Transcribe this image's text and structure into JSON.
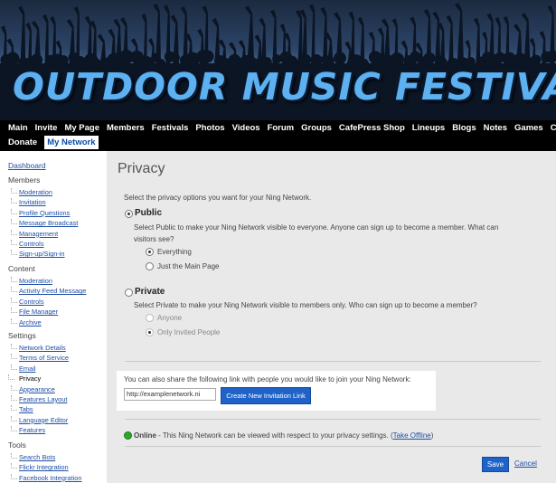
{
  "site": {
    "title": "OUTDOOR MUSIC FESTIVALS"
  },
  "nav": {
    "row1": [
      "Main",
      "Invite",
      "My Page",
      "Members",
      "Festivals",
      "Photos",
      "Videos",
      "Forum",
      "Groups",
      "CafePress Shop",
      "Lineups",
      "Blogs",
      "Notes",
      "Games",
      "Chat"
    ],
    "row2": [
      "Donate",
      "My Network"
    ],
    "active": "My Network"
  },
  "sidebar": {
    "dashboard": "Dashboard",
    "sections": [
      {
        "heading": "Members",
        "items": [
          "Moderation",
          "Invitation",
          "Profile Questions",
          "Message Broadcast",
          "Management",
          "Controls",
          "Sign-up/Sign-in"
        ]
      },
      {
        "heading": "Content",
        "items": [
          "Moderation",
          "Activity Feed Message",
          "Controls",
          "File Manager",
          "Archive"
        ]
      },
      {
        "heading": "Settings",
        "items": [
          "Network Details",
          "Terms of Service",
          "Email",
          "Privacy",
          "Appearance",
          "Features Layout",
          "Tabs",
          "Language Editor",
          "Features"
        ]
      },
      {
        "heading": "Tools",
        "items": [
          "Search Bots",
          "Flickr Integration",
          "Facebook Integration"
        ]
      }
    ],
    "current": "Privacy"
  },
  "main": {
    "title": "Privacy",
    "intro": "Select the privacy options you want for your Ning Network.",
    "public": {
      "label": "Public",
      "desc_line1": "Select Public to make your Ning Network visible to everyone. Anyone can sign up to become a member. What can",
      "desc_line2": "visitors see?",
      "options": [
        "Everything",
        "Just the Main Page"
      ],
      "selected": "Everything"
    },
    "private": {
      "label": "Private",
      "desc": "Select Private to make your Ning Network visible to members only. Who can sign up to become a member?",
      "options": [
        "Anyone",
        "Only Invited People"
      ],
      "selected": "Only Invited People"
    },
    "share": {
      "text": "You can also share the following link with people you would like to join your Ning Network:",
      "link_value": "http://examplenetwork.ni",
      "button": "Create New Invitation Link"
    },
    "status": {
      "label": "Online",
      "text": " - This Ning Network can be viewed with respect to your privacy settings. (",
      "link": "Take Offline",
      "close": ")"
    },
    "save": "Save",
    "cancel": "Cancel"
  },
  "colors": {
    "accent": "#1f63c8",
    "nav_bg": "#000000",
    "online": "#2aa62a"
  }
}
